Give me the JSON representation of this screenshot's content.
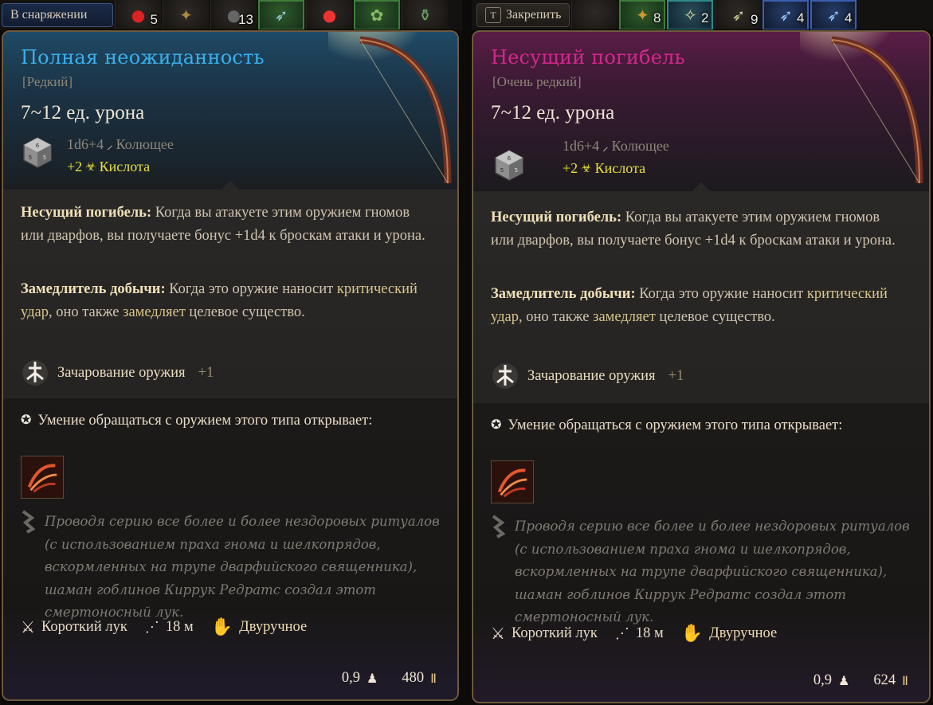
{
  "hotbar_left": {
    "tab_label": "В снаряжении",
    "slots": [
      {
        "icon": "red-potion-icon",
        "count": "5"
      },
      {
        "icon": "scroll-icon",
        "count": ""
      },
      {
        "icon": "bomb-icon",
        "count": "13"
      },
      {
        "icon": "arrow-icon",
        "count": ""
      },
      {
        "icon": "apple-icon",
        "count": ""
      },
      {
        "icon": "herb-icon",
        "count": ""
      },
      {
        "icon": "flask-icon",
        "count": ""
      }
    ]
  },
  "hotbar_right": {
    "tab_key": "T",
    "tab_label": "Закрепить",
    "slots": [
      {
        "icon": "empty-slot",
        "count": ""
      },
      {
        "icon": "arrows-bundle-icon",
        "count": "8"
      },
      {
        "icon": "mace-icon",
        "count": "2"
      },
      {
        "icon": "arrow-icon",
        "count": "9"
      },
      {
        "icon": "arrow-icon",
        "count": "4"
      },
      {
        "icon": "arrow-icon",
        "count": "4"
      }
    ]
  },
  "cards": [
    {
      "title": "Полная неожиданность",
      "rarity": "[Редкий]",
      "damage": "7~12 ед. урона",
      "dice": "1d6+4",
      "damage_type": "Колющее",
      "bonus": "+2",
      "bonus_type": "Кислота",
      "passive1_name": "Несущий погибель:",
      "passive1_text_a": " Когда вы атакуете этим оружием гномов или дварфов, вы получаете бонус +1d4 к броскам атаки и урона.",
      "passive2_name": "Замедлитель добычи:",
      "passive2_text_a": " Когда это оружие наносит ",
      "passive2_hl1": "критический удар",
      "passive2_text_b": ", оно также ",
      "passive2_hl2": "замедляет",
      "passive2_text_c": " целевое существо.",
      "enchant_label": "Зачарование оружия",
      "enchant_value": "+1",
      "proficiency": "Умение обращаться с оружием этого типа открывает:",
      "lore": "Проводя серию все более и более нездоровых ритуалов (с использованием праха гнома и шелкопрядов, вскормленных на трупе дварфийского священника), шаман гоблинов Киррук Редратс создал этот смертоносный лук.",
      "weapon_type": "Короткий лук",
      "range": "18 м",
      "handedness": "Двуручное",
      "weight": "0,9",
      "price": "480",
      "accent": "#3ab0ec"
    },
    {
      "title": "Несущий погибель",
      "rarity": "[Очень редкий]",
      "damage": "7~12 ед. урона",
      "dice": "1d6+4",
      "damage_type": "Колющее",
      "bonus": "+2",
      "bonus_type": "Кислота",
      "passive1_name": "Несущий погибель:",
      "passive1_text_a": " Когда вы атакуете этим оружием гномов или дварфов, вы получаете бонус +1d4 к броскам атаки и урона.",
      "passive2_name": "Замедлитель добычи:",
      "passive2_text_a": " Когда это оружие наносит ",
      "passive2_hl1": "критический удар",
      "passive2_text_b": ", оно также ",
      "passive2_hl2": "замедляет",
      "passive2_text_c": " целевое существо.",
      "enchant_label": "Зачарование оружия",
      "enchant_value": "+1",
      "proficiency": "Умение обращаться с оружием этого типа открывает:",
      "lore": "Проводя серию все более и более нездоровых ритуалов (с использованием праха гнома и шелкопрядов, вскормленных на трупе дварфийского священника), шаман гоблинов Киррук Редратс создал этот смертоносный лук.",
      "weapon_type": "Короткий лук",
      "range": "18 м",
      "handedness": "Двуручное",
      "weight": "0,9",
      "price": "624",
      "accent": "#d5278d"
    }
  ]
}
